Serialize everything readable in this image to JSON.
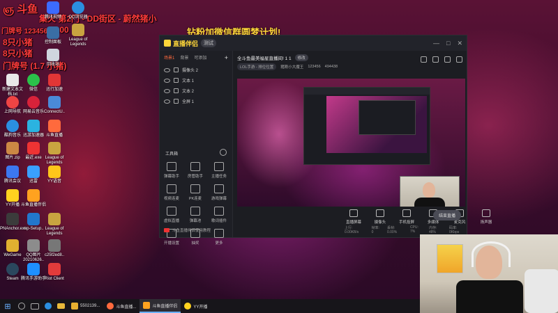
{
  "overlay": {
    "line1": "ஞ 斗鱼",
    "line1_rest": "集火 第2门 - DD街区 - 蔚然猪小",
    "line2": "门牌号 123456",
    "line2_rest": "17:00",
    "line3": "8只小猪",
    "line4": "8只小猪",
    "line5": "门牌号 (1.7 小猪)"
  },
  "banner_main": "钻粉加微信群圆梦计划!",
  "desktop_icons": [
    {
      "label": "新建文本文档.txt",
      "color": "#e8e8e8"
    },
    {
      "label": "微信",
      "color": "#2bc14a"
    },
    {
      "label": "迅行加速",
      "color": "#e23636"
    },
    {
      "label": "上网导航",
      "color": "#e44"
    },
    {
      "label": "网易云音乐",
      "color": "#d8223a"
    },
    {
      "label": "ConnectU..",
      "color": "#4a8ad8"
    },
    {
      "label": "酷狗音乐",
      "color": "#2b8fe0"
    },
    {
      "label": "迅游加速器",
      "color": "#2bb3e0"
    },
    {
      "label": "斗鱼直播",
      "color": "#ff6a3d"
    },
    {
      "label": "图片.zip",
      "color": "#c84"
    },
    {
      "label": "最近.exe",
      "color": "#e33"
    },
    {
      "label": "League of Legends",
      "color": "#c9a440"
    },
    {
      "label": "腾讯会议",
      "color": "#3c78f0"
    },
    {
      "label": "迅雷",
      "color": "#3aa0ff"
    },
    {
      "label": "YY语音",
      "color": "#ffc61a"
    },
    {
      "label": "YY开播",
      "color": "#ffd21f"
    },
    {
      "label": "斗鱼直播伴侣",
      "color": "#ffa21f"
    },
    {
      "label": "PNAnchor.exe",
      "color": "#3b3b3b"
    },
    {
      "label": "mp-Setup..",
      "color": "#2277cc"
    },
    {
      "label": "League of Legends",
      "color": "#c9a440"
    },
    {
      "label": "WeGame",
      "color": "#e0b030"
    },
    {
      "label": "QQ图片 20210626..",
      "color": "#8c8c8c"
    },
    {
      "label": "c25f2ed8..",
      "color": "#777"
    },
    {
      "label": "Steam",
      "color": "#2a475e"
    },
    {
      "label": "腾讯手游助手",
      "color": "#1e90ff"
    },
    {
      "label": "Riot Client",
      "color": "#e23b3b"
    }
  ],
  "top_icons": [
    {
      "label": "腾讯视频",
      "color": "#3c6bff"
    },
    {
      "label": "QQ浏览器",
      "color": "#2b8fe0"
    },
    {
      "label": "League of Legends",
      "color": "#c9a440"
    },
    {
      "label": "控制面板",
      "color": "#3a6ea5"
    },
    {
      "label": "回收站",
      "color": "#cfd6de"
    }
  ],
  "app": {
    "name": "直播伴侣",
    "badge": "测试",
    "sidebar_tabs": [
      "场景1",
      "背景",
      "可添加"
    ],
    "sources": [
      "摄像头 2",
      "文本 1",
      "文本 2",
      "全屏 1"
    ],
    "tools_title": "工具箱",
    "tools": [
      "弹幕助手",
      "房管助手",
      "主播任务",
      "视频连麦",
      "PK连麦",
      "游戏弹幕",
      "虚拟直播",
      "弹幕池",
      "歌词插件",
      "开播设置",
      "抽奖",
      "更多"
    ],
    "promo": "斗鱼直播伴侣使用教程",
    "room_title": "全斗鱼最美福星直播间! 1 1",
    "room_chip": "修改",
    "category": "LOL手游 - 排位位置",
    "room_name": "猪刚小大魔王",
    "room_id": "123456",
    "viewers": "494438",
    "controls": [
      "直播屏幕",
      "摄像头",
      "手机投屏",
      "多媒体",
      "麦克风",
      "扬声器"
    ],
    "go_live": "结束直播",
    "status": [
      "上行: 0.00KB/s",
      "帧率: 0",
      "丢帧: 0.00%",
      "CPU: 7%",
      "内存: 48%",
      "码率: 0Kbps"
    ]
  },
  "taskbar": {
    "apps": [
      {
        "label": "5502139...",
        "color": "#e8b030"
      },
      {
        "label": "斗鱼直播...",
        "color": "#ff6a3d"
      },
      {
        "label": "斗鱼直播伴侣",
        "color": "#ffa21f"
      },
      {
        "label": "YY开播",
        "color": "#ffd21f"
      }
    ]
  },
  "colors": {
    "accent": "#ff6a3d",
    "overlay_red": "#ff3b3b",
    "banner": "#ffd73a"
  }
}
